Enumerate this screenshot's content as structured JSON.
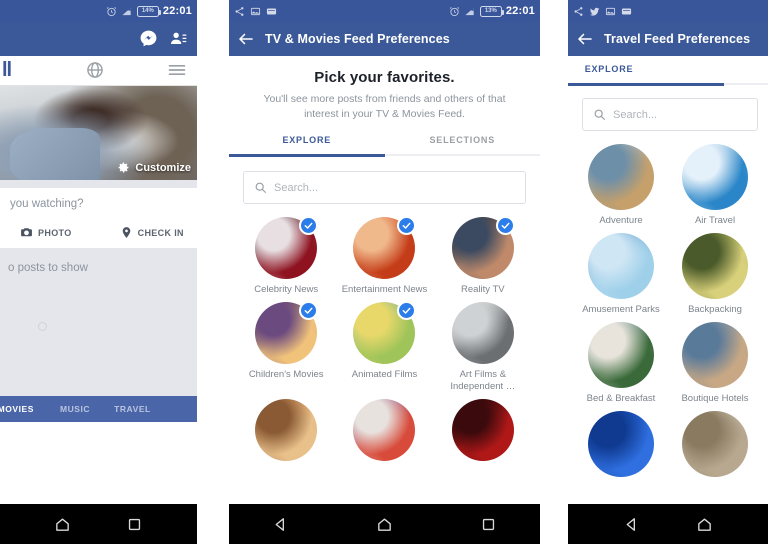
{
  "left_panel": {
    "status_bar": {
      "icons": [
        "alarm-icon",
        "signal-icon"
      ],
      "battery_percent": "14%",
      "time": "22:01"
    },
    "app_bar": {
      "messenger_label": "messenger-icon",
      "friend_requests_label": "friend-requests-icon"
    },
    "sub_bar": {
      "logo_text": "ll",
      "globe_label": "globe-icon",
      "menu_label": "hamburger-menu-icon"
    },
    "hero": {
      "customize_label": "Customize"
    },
    "composer": {
      "prompt": "you watching?",
      "actions": [
        {
          "label": "PHOTO",
          "icon": "camera-icon"
        },
        {
          "label": "CHECK IN",
          "icon": "location-pin-icon"
        }
      ]
    },
    "feed": {
      "empty_text": "o posts to show"
    },
    "bottom_tabs": [
      {
        "label": "& MOVIES",
        "active": true
      },
      {
        "label": "MUSIC",
        "active": false
      },
      {
        "label": "TRAVEL",
        "active": false
      }
    ],
    "nav_bar": {
      "buttons": [
        "home-icon",
        "recents-icon"
      ]
    }
  },
  "middle_panel": {
    "status_bar": {
      "icons": [
        "share-icon",
        "image-icon",
        "email-icon",
        "alarm-icon",
        "signal-icon"
      ],
      "battery_percent": "13%",
      "time": "22:01"
    },
    "app_bar": {
      "back_label": "back-arrow-icon",
      "title": "TV & Movies Feed Preferences"
    },
    "headline": "Pick your favorites.",
    "subhead": "You'll see more posts from friends and others of that interest in your TV & Movies Feed.",
    "tabs": [
      {
        "label": "EXPLORE",
        "active": true
      },
      {
        "label": "SELECTIONS",
        "active": false
      }
    ],
    "search": {
      "placeholder": "Search...",
      "value": ""
    },
    "tiles": [
      {
        "label": "Celebrity News",
        "selected": true,
        "c1": "#1b0d18",
        "c2": "#8e1220",
        "c3": "#e7dfe2"
      },
      {
        "label": "Entertainment News",
        "selected": true,
        "c1": "#e06030",
        "c2": "#c43c18",
        "c3": "#f0b98c"
      },
      {
        "label": "Reality TV",
        "selected": true,
        "c1": "#241a16",
        "c2": "#c08a6a",
        "c3": "#3b4a60"
      },
      {
        "label": "Children's Movies",
        "selected": true,
        "c1": "#3c2a55",
        "c2": "#f0c27a",
        "c3": "#6b4a80"
      },
      {
        "label": "Animated Films",
        "selected": true,
        "c1": "#5fa8d8",
        "c2": "#9ec45a",
        "c3": "#e8d86a"
      },
      {
        "label": "Art Films & Independent …",
        "selected": false,
        "c1": "#f2f0ec",
        "c2": "#6b6f72",
        "c3": "#cfd2d4"
      },
      {
        "label": "",
        "selected": false,
        "c1": "#f3a35c",
        "c2": "#e8c08a",
        "c3": "#8a5a34"
      },
      {
        "label": "",
        "selected": false,
        "c1": "#6a4fa3",
        "c2": "#d84a3a",
        "c3": "#e8e2de"
      },
      {
        "label": "",
        "selected": false,
        "c1": "#1a0608",
        "c2": "#b01818",
        "c3": "#3a0a0c"
      }
    ],
    "nav_bar": {
      "buttons": [
        "back-icon",
        "home-icon",
        "recents-icon"
      ]
    }
  },
  "right_panel": {
    "status_bar": {
      "icons": [
        "share-icon",
        "twitter-icon",
        "image-icon",
        "email-icon"
      ]
    },
    "app_bar": {
      "back_label": "back-arrow-icon",
      "title": "Travel Feed Preferences"
    },
    "tabs": [
      {
        "label": "EXPLORE",
        "active": true
      }
    ],
    "search": {
      "placeholder": "Search...",
      "value": ""
    },
    "tiles": [
      {
        "label": "Adventure",
        "selected": false,
        "c1": "#cfe0ec",
        "c2": "#c6a06a",
        "c3": "#6e8fa8"
      },
      {
        "label": "Air Travel",
        "selected": false,
        "c1": "#cfe2f2",
        "c2": "#2a86c8",
        "c3": "#e4f0fa"
      },
      {
        "label": "Amusement Parks",
        "selected": false,
        "c1": "#2f7fbf",
        "c2": "#9fd0ea",
        "c3": "#cfe6f4"
      },
      {
        "label": "Backpacking",
        "selected": false,
        "c1": "#9fb04a",
        "c2": "#d8d07a",
        "c3": "#4a5a2a"
      },
      {
        "label": "Bed & Breakfast",
        "selected": false,
        "c1": "#7fa0c0",
        "c2": "#3a6a3a",
        "c3": "#e8e4dc"
      },
      {
        "label": "Boutique Hotels",
        "selected": false,
        "c1": "#8fa8c0",
        "c2": "#c8a884",
        "c3": "#5a7a9a"
      },
      {
        "label": "",
        "selected": false,
        "c1": "#1450c8",
        "c2": "#2f6fe0",
        "c3": "#0f3a90"
      },
      {
        "label": "",
        "selected": false,
        "c1": "#e8e4dc",
        "c2": "#b8a890",
        "c3": "#8a7a60"
      }
    ],
    "nav_bar": {
      "buttons": [
        "back-icon",
        "home-icon"
      ]
    }
  },
  "colors": {
    "fb_blue": "#3b5998",
    "fb_status": "#3a569b",
    "tab_blue": "#4a66a8",
    "check_blue": "#2b7de9",
    "grey_text": "#8d949e",
    "feed_grey": "#e4e6eb"
  }
}
